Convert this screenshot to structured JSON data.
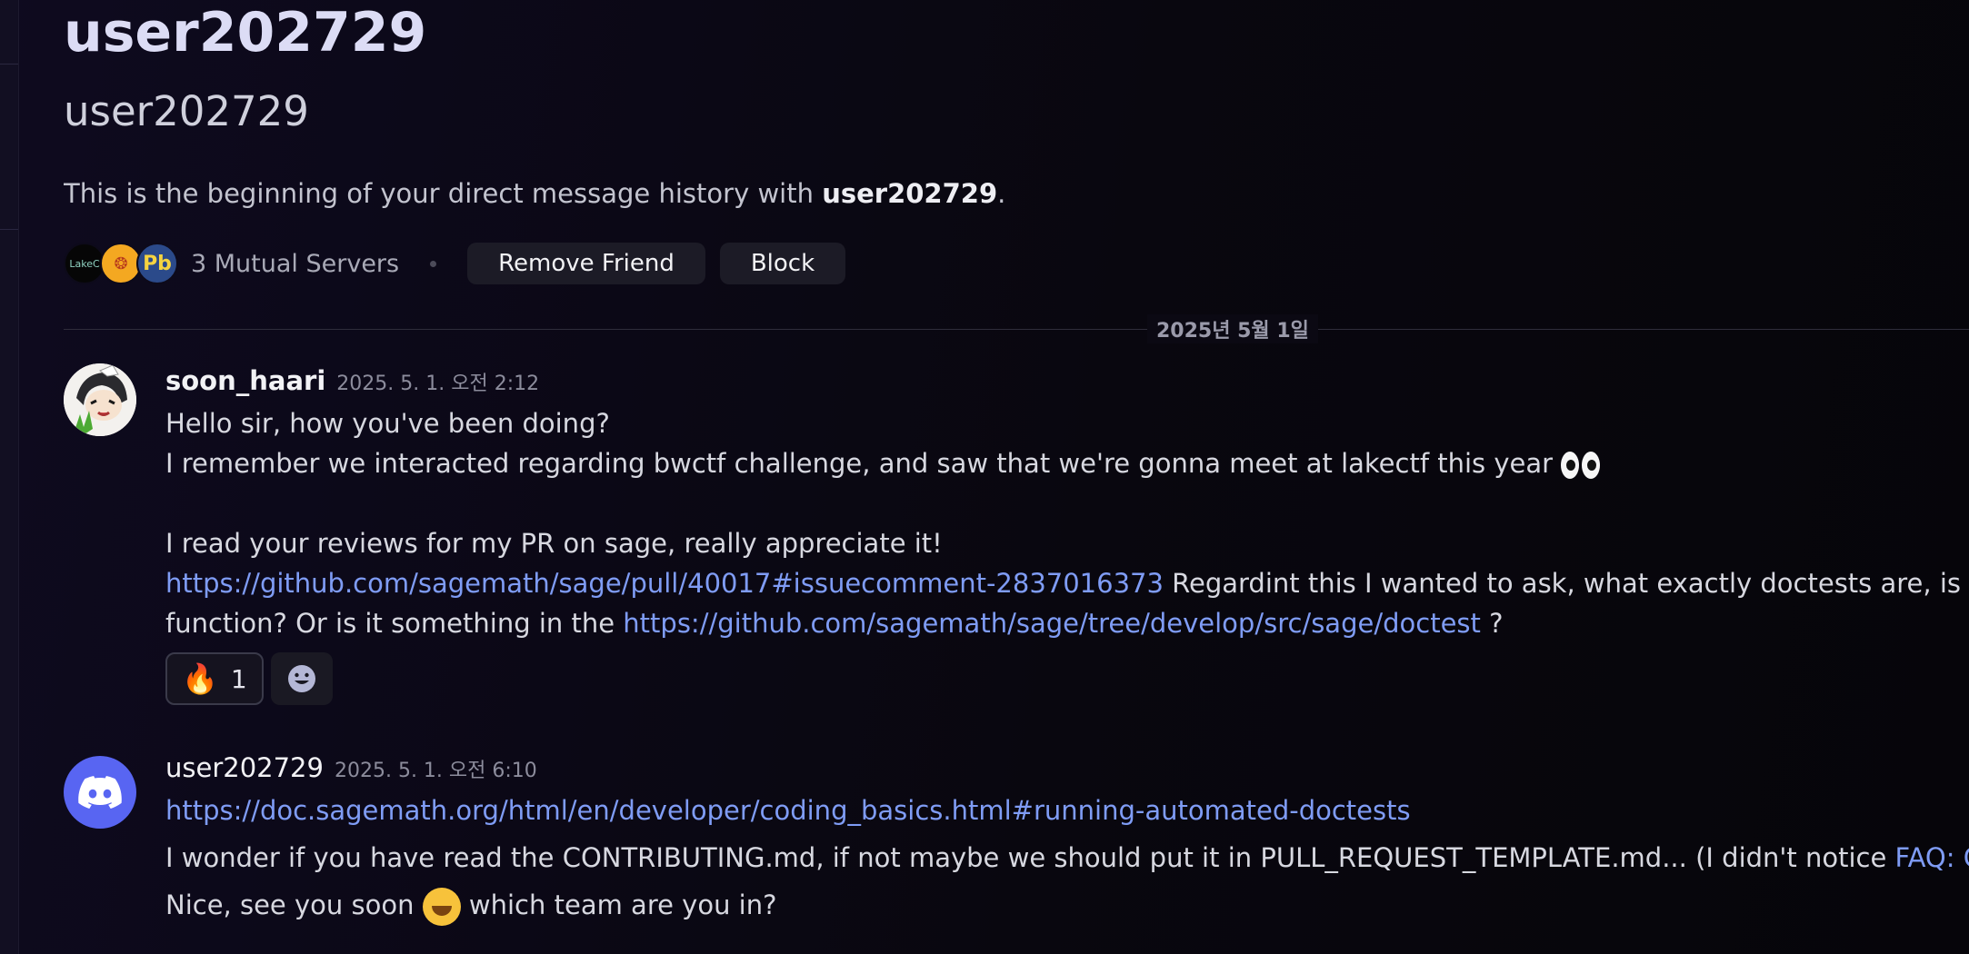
{
  "profile": {
    "display_name": "user202729",
    "username": "user202729",
    "intro_prefix": "This is the beginning of your direct message history with ",
    "intro_name": "user202729",
    "intro_suffix": ".",
    "servers": [
      {
        "icon": "lakectf-server-icon",
        "label": "LakeC"
      },
      {
        "icon": "orange-server-icon",
        "label": "❂"
      },
      {
        "icon": "pb-server-icon",
        "label": "Pb"
      }
    ],
    "mutual_servers": "3 Mutual Servers",
    "remove_friend": "Remove Friend",
    "block": "Block"
  },
  "date_divider": "2025년 5월 1일",
  "messages": [
    {
      "author": "soon_haari",
      "timestamp": "2025. 5. 1. 오전 2:12",
      "lines": {
        "l1": "Hello sir, how you've been doing?",
        "l2": "I remember we interacted regarding bwctf challenge, and saw that we're gonna meet at lakectf this year ",
        "l3": "I read your reviews for my PR on sage, really appreciate it!",
        "l4_link": "https://github.com/sagemath/sage/pull/40017#issuecomment-2837016373",
        "l4_text": " Regardint this I wanted to ask, what exactly doctests are, is it just exam",
        "l5_text": "function? Or is it something in the ",
        "l5_link": "https://github.com/sagemath/sage/tree/develop/src/sage/doctest",
        "l5_tail": " ?"
      },
      "reactions": [
        {
          "emoji": "🔥",
          "count": "1"
        }
      ]
    },
    {
      "author": "user202729",
      "timestamp": "2025. 5. 1. 오전 6:10",
      "lines": {
        "l1_link": "https://doc.sagemath.org/html/en/developer/coding_basics.html#running-automated-doctests",
        "l2_text": "I wonder if you have read the CONTRIBUTING.md, if not maybe we should put it in PULL_REQUEST_TEMPLATE.md... (I didn't notice ",
        "l2_link": "FAQ: Contribut",
        "l3_a": "Nice, see you soon ",
        "l3_b": " which team are you in?"
      }
    }
  ]
}
